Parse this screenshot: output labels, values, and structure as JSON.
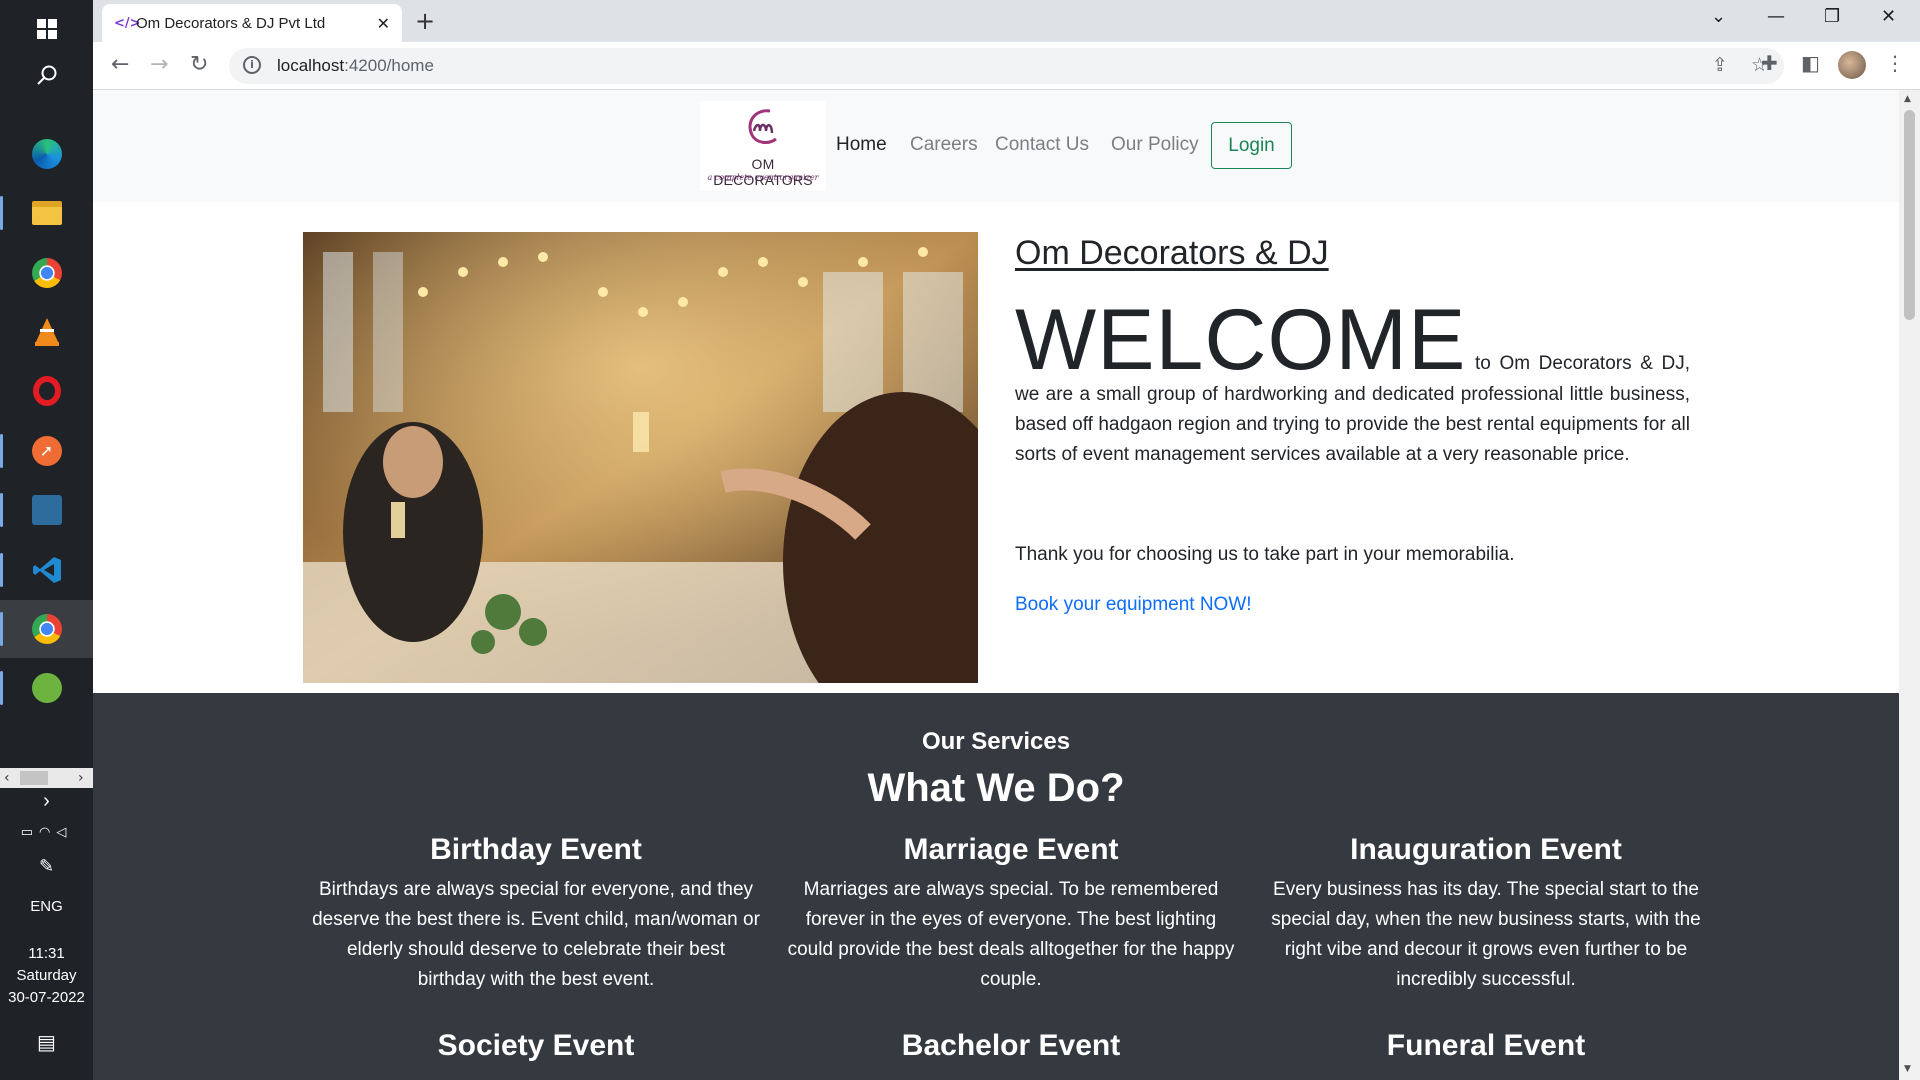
{
  "taskbar": {
    "apps": [
      "windows-start-icon",
      "search-icon",
      "edge-icon",
      "file-explorer-icon",
      "chrome-icon",
      "vlc-icon",
      "opera-icon",
      "postman-icon",
      "mysql-workbench-icon",
      "vscode-icon",
      "chrome-profile-icon",
      "spring-tool-icon"
    ],
    "language": "ENG",
    "time": "11:31",
    "day": "Saturday",
    "date": "30-07-2022"
  },
  "browser": {
    "tab_title": "Om Decorators & DJ Pvt Ltd",
    "url_host": "localhost",
    "url_path": ":4200/home"
  },
  "site": {
    "logo": {
      "brand": "OM DECORATORS",
      "tagline": "a complete event organizer"
    },
    "nav": {
      "home": "Home",
      "careers": "Careers",
      "contact": "Contact Us",
      "policy": "Our Policy",
      "login": "Login"
    },
    "hero": {
      "title": "Om Decorators & DJ",
      "welcome": "WELCOME",
      "intro": " to Om Decorators & DJ, we are a small group of hardworking and dedicated professional little business, based off hadgaon region and trying to provide the best rental equipments for all sorts of event management services available at a very reasonable price.",
      "thanks": "Thank you for choosing us to take part in your memorabilia.",
      "cta": "Book your equipment NOW!"
    },
    "services": {
      "kicker": "Our Services",
      "heading": "What We Do?",
      "cards": [
        {
          "title": "Birthday Event",
          "text": "Birthdays are always special for everyone, and they deserve the best there is. Event child, man/woman or elderly should deserve to celebrate their best birthday with the best event."
        },
        {
          "title": "Marriage Event",
          "text": "Marriages are always special. To be remembered forever in the eyes of everyone. The best lighting could provide the best deals alltogether for the happy couple."
        },
        {
          "title": "Inauguration Event",
          "text": "Every business has its day. The special start to the special day, when the new business starts, with the right vibe and decour it grows even further to be incredibly successful."
        },
        {
          "title": "Society Event",
          "text": ""
        },
        {
          "title": "Bachelor Event",
          "text": ""
        },
        {
          "title": "Funeral Event",
          "text": ""
        }
      ]
    }
  },
  "colors": {
    "services_bg": "#343a40",
    "nav_bg": "#f8f9fa",
    "login_green": "#198754",
    "link_blue": "#0d6efd"
  }
}
